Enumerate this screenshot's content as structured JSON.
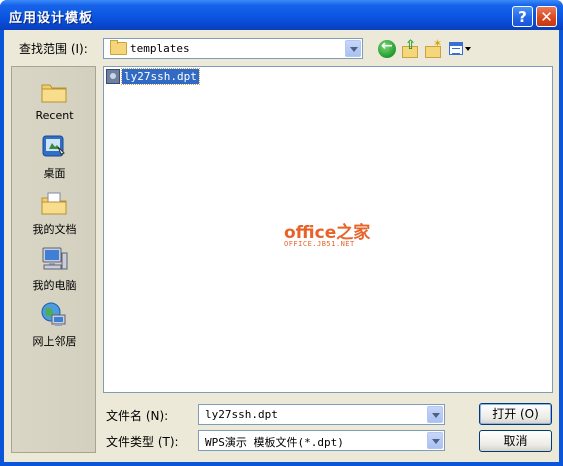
{
  "window": {
    "title": "应用设计模板",
    "help_button": "?",
    "close_button": "✕"
  },
  "toolbar": {
    "lookin_label": "查找范围 (I):",
    "lookin_value": "templates",
    "icons": [
      "back-icon",
      "up-folder-icon",
      "new-folder-icon",
      "view-menu-icon"
    ]
  },
  "places": [
    {
      "label": "Recent",
      "icon": "recent-folder-icon"
    },
    {
      "label": "桌面",
      "icon": "desktop-icon"
    },
    {
      "label": "我的文档",
      "icon": "my-documents-icon"
    },
    {
      "label": "我的电脑",
      "icon": "my-computer-icon"
    },
    {
      "label": "网上邻居",
      "icon": "network-places-icon"
    }
  ],
  "files": [
    {
      "name": "ly27ssh.dpt",
      "selected": true
    }
  ],
  "watermark": {
    "brand": "office之家",
    "url": "OFFICE.JB51.NET"
  },
  "bottom": {
    "filename_label": "文件名 (N):",
    "filename_value": "ly27ssh.dpt",
    "filetype_label": "文件类型 (T):",
    "filetype_value": "WPS演示 模板文件(*.dpt)",
    "open_button": "打开 (O)",
    "cancel_button": "取消"
  },
  "colors": {
    "titlebar": "#0b55e0",
    "dialog_bg": "#ece9d8",
    "selection": "#316ac5",
    "watermark": "#e8632a"
  }
}
